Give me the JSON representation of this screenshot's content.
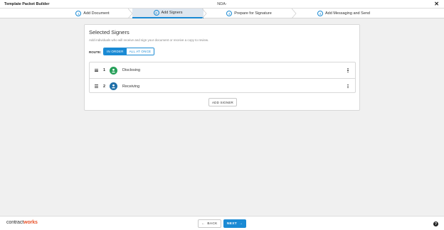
{
  "window": {
    "app_title": "Template Packet Builder",
    "doc_title": "NDA-",
    "close_icon": "close-icon"
  },
  "steps": [
    {
      "num": "1",
      "label": "Add Document",
      "active": false
    },
    {
      "num": "2",
      "label": "Add Signers",
      "active": true
    },
    {
      "num": "3",
      "label": "Prepare for Signature",
      "active": false
    },
    {
      "num": "4",
      "label": "Add Messaging and Send",
      "active": false
    }
  ],
  "card": {
    "title": "Selected Signers",
    "subtitle": "Add individuals who will receive and sign your document or receive a copy to review.",
    "route_label": "ROUTE:",
    "route_options": [
      "IN ORDER",
      "ALL AT ONCE"
    ],
    "route_selected": "IN ORDER",
    "signers": [
      {
        "order": "1",
        "name": "Disclosing",
        "avatar_color": "#27a05a",
        "icon": "user-icon"
      },
      {
        "order": "2",
        "name": "Receiving",
        "avatar_color": "#1f6fa8",
        "icon": "user-icon"
      }
    ],
    "add_signer_label": "ADD SIGNER"
  },
  "footer": {
    "logo_part1": "contract",
    "logo_part2": "works",
    "back_label": "BACK",
    "next_label": "NEXT",
    "help_label": "?"
  },
  "colors": {
    "accent": "#1a8ad4",
    "brand_orange": "#e8542c",
    "active_step_bg": "#dde6ef"
  }
}
